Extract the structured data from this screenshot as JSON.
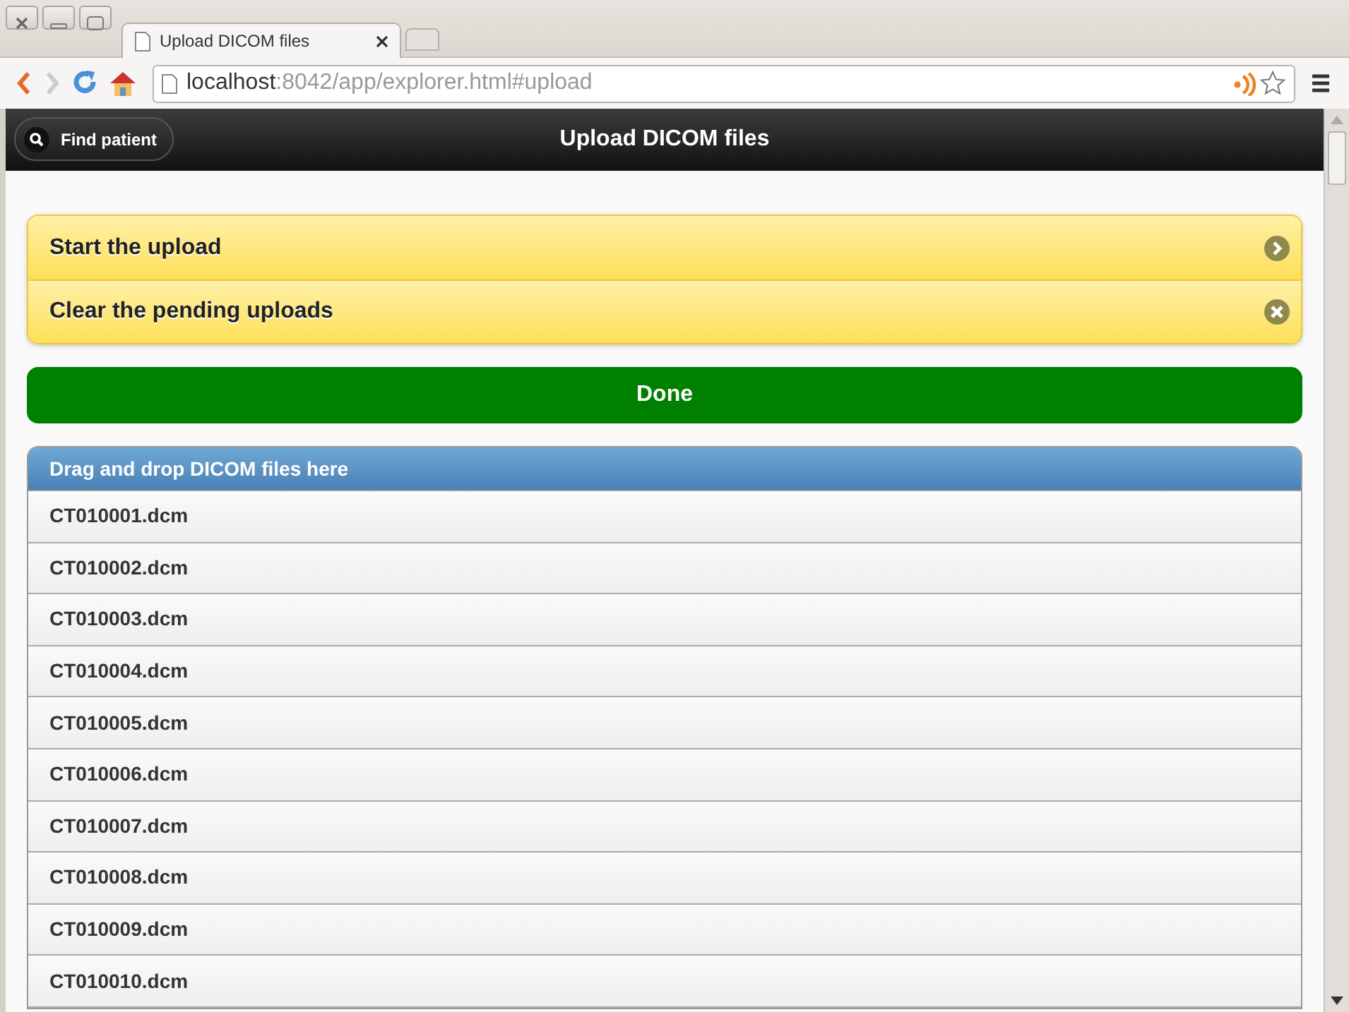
{
  "browser": {
    "tab_title": "Upload DICOM files",
    "url_host": "localhost",
    "url_path": ":8042/app/explorer.html#upload"
  },
  "header": {
    "back_button": "Find patient",
    "title": "Upload DICOM files"
  },
  "actions": [
    {
      "label": "Start the upload",
      "kind": "next"
    },
    {
      "label": "Clear the pending uploads",
      "kind": "clear"
    }
  ],
  "done_button": "Done",
  "dropzone": {
    "title": "Drag and drop DICOM files here",
    "files": [
      "CT010001.dcm",
      "CT010002.dcm",
      "CT010003.dcm",
      "CT010004.dcm",
      "CT010005.dcm",
      "CT010006.dcm",
      "CT010007.dcm",
      "CT010008.dcm",
      "CT010009.dcm",
      "CT010010.dcm"
    ]
  }
}
